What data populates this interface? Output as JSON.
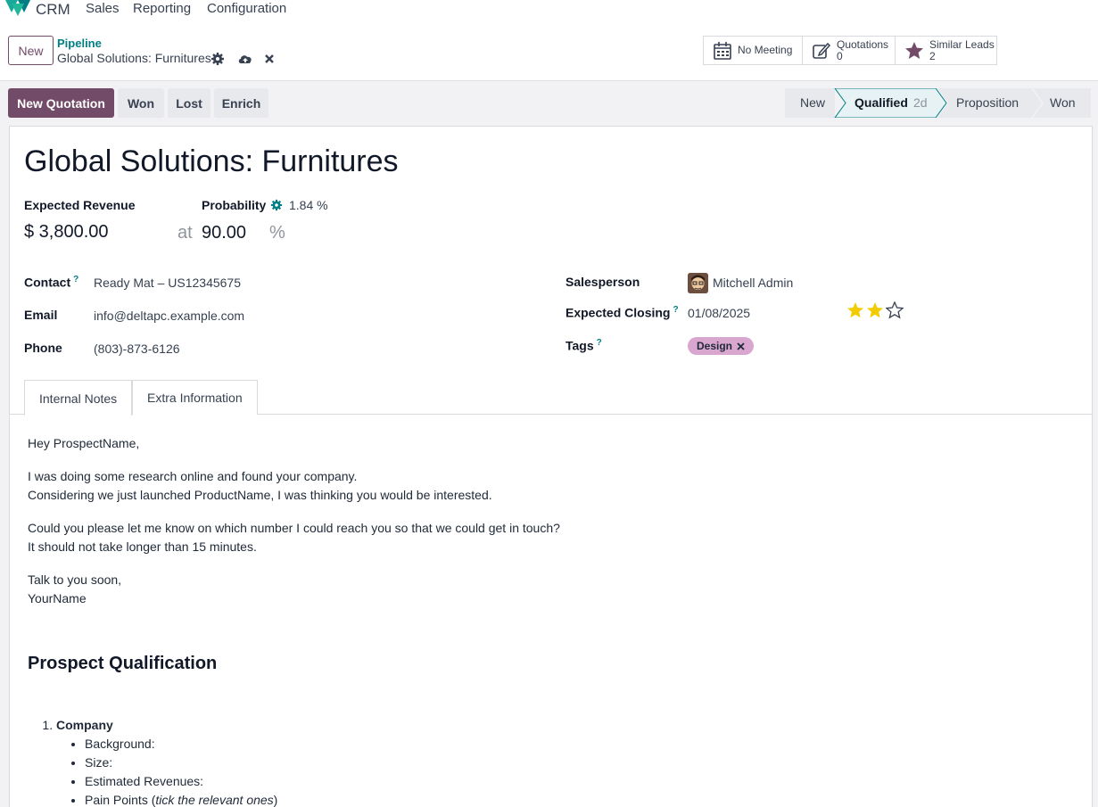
{
  "nav": {
    "app_name": "CRM",
    "menu": [
      "Sales",
      "Reporting",
      "Configuration"
    ]
  },
  "control_panel": {
    "new_label": "New",
    "breadcrumb_parent": "Pipeline",
    "breadcrumb_current": "Global Solutions: Furnitures",
    "smart_buttons": [
      {
        "label": "No Meeting",
        "count": "",
        "icon": "calendar-icon"
      },
      {
        "label": "Quotations",
        "count": "0",
        "icon": "edit-icon"
      },
      {
        "label": "Similar Leads",
        "count": "2",
        "icon": "star-icon"
      }
    ]
  },
  "actions": {
    "new_quotation": "New Quotation",
    "won": "Won",
    "lost": "Lost",
    "enrich": "Enrich"
  },
  "stages": {
    "items": [
      "New",
      "Qualified",
      "Proposition",
      "Won"
    ],
    "active": "Qualified",
    "active_duration": "2d"
  },
  "lead": {
    "title": "Global Solutions: Furnitures",
    "expected_revenue_label": "Expected Revenue",
    "expected_revenue": "$ 3,800.00",
    "at": "at",
    "probability_label": "Probability",
    "auto_probability": "1.84 %",
    "probability": "90.00",
    "percent": "%",
    "contact_label": "Contact",
    "contact": "Ready Mat – US12345675",
    "email_label": "Email",
    "email": "info@deltapc.example.com",
    "phone_label": "Phone",
    "phone": "(803)-873-6126",
    "salesperson_label": "Salesperson",
    "salesperson": "Mitchell Admin",
    "closing_label": "Expected Closing",
    "closing": "01/08/2025",
    "priority_stars": 2,
    "priority_max": 3,
    "tags_label": "Tags",
    "tag": "Design",
    "help_mark": "?"
  },
  "tabs": [
    "Internal Notes",
    "Extra Information"
  ],
  "notes": {
    "greeting": "Hey ProspectName,",
    "p1_line1": "I was doing some research online and found your company.",
    "p1_line2": "Considering we just launched ProductName, I was thinking you would be interested.",
    "p2_line1": "Could you please let me know on which number I could reach you so that we could get in touch?",
    "p2_line2": "It should not take longer than 15 minutes.",
    "closing1": "Talk to you soon,",
    "closing2": "YourName",
    "heading": "Prospect Qualification",
    "section_title": "Company",
    "bullets": [
      "Background:",
      "Size:",
      "Estimated Revenues:"
    ],
    "pain_points_prefix": "Pain Points (",
    "pain_points_em": "tick the relevant ones",
    "pain_points_suffix": ")"
  },
  "colors": {
    "primary": "#714b67",
    "teal": "#017e84",
    "star_filled": "#f3cc00",
    "tag_bg": "#d9a6cf"
  }
}
